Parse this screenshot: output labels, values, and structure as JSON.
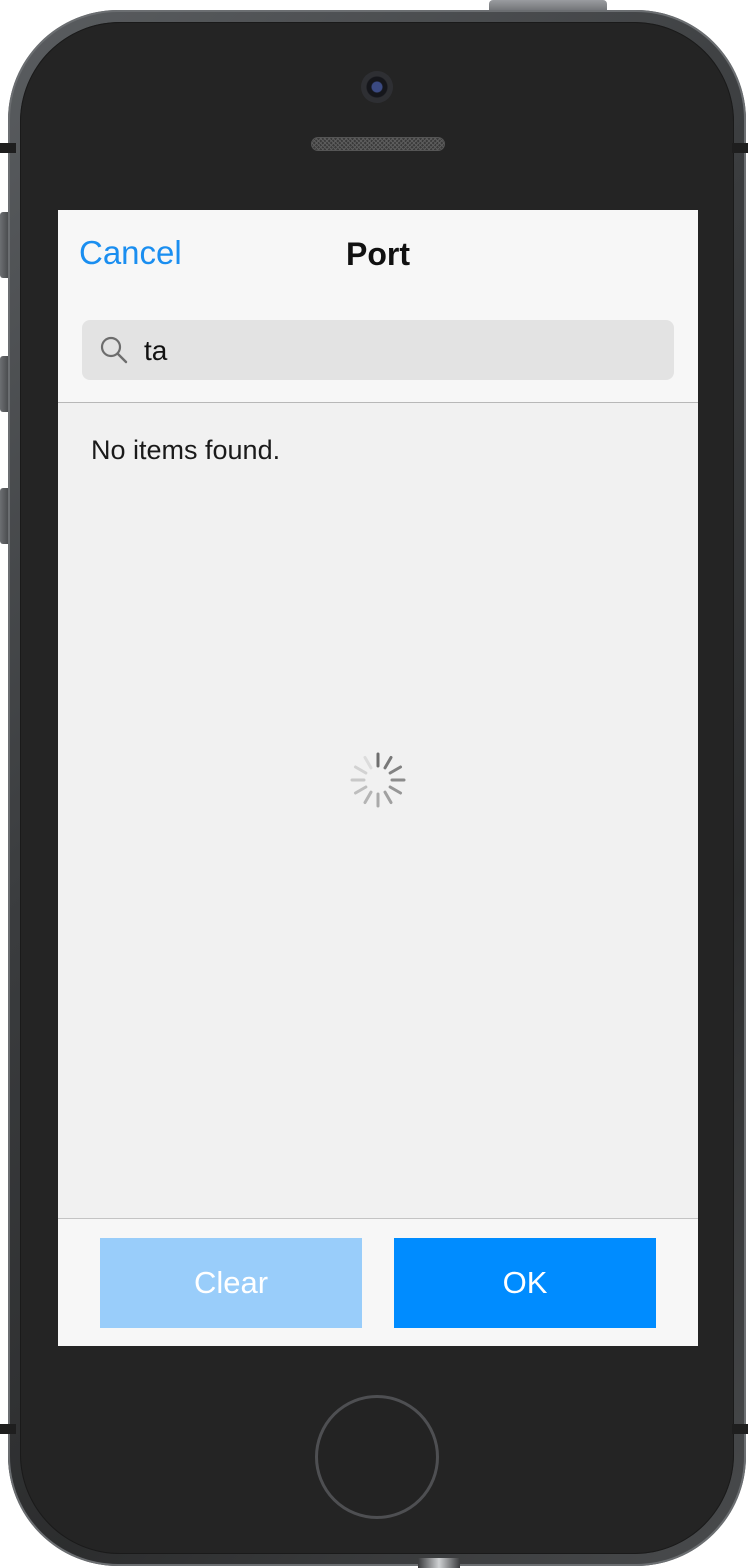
{
  "header": {
    "cancel_label": "Cancel",
    "title": "Port"
  },
  "search": {
    "value": "ta",
    "icon": "search-icon"
  },
  "results": {
    "empty_message": "No items found.",
    "loading": true
  },
  "footer": {
    "clear_label": "Clear",
    "ok_label": "OK"
  },
  "colors": {
    "accent": "#1a8ef0",
    "ok_button": "#008cff",
    "clear_button_disabled": "#99cdfa",
    "screen_background": "#f1f1f1"
  }
}
